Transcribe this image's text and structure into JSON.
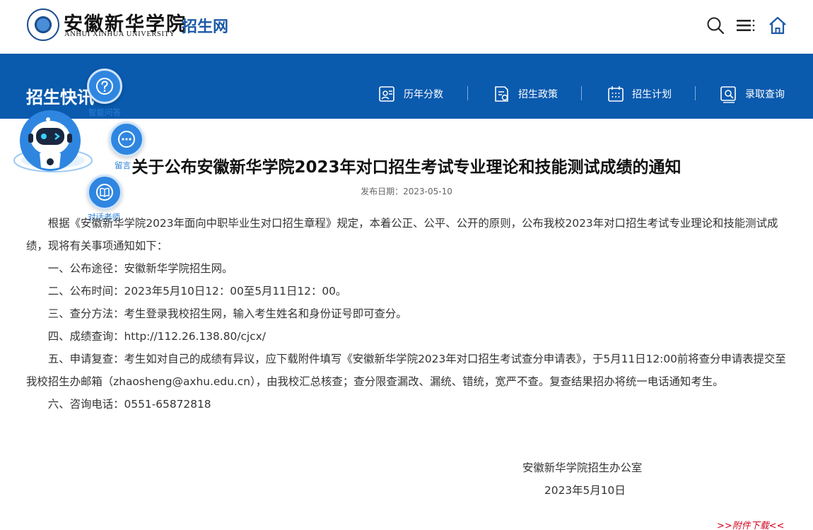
{
  "header": {
    "logo_cn": "安徽新华学院",
    "logo_en": "ANHUI XINHUA UNIVERSITY",
    "site_name": "招生网"
  },
  "band": {
    "title": "招生快讯",
    "nav": [
      {
        "label": "历年分数",
        "icon": "score-history-icon"
      },
      {
        "label": "招生政策",
        "icon": "policy-icon"
      },
      {
        "label": "招生计划",
        "icon": "calendar-icon"
      },
      {
        "label": "录取查询",
        "icon": "admission-query-icon"
      }
    ]
  },
  "assistant": {
    "qa_label": "智能问答",
    "msg_label": "留言",
    "teacher_label": "对话老师"
  },
  "article": {
    "title": "关于公布安徽新华学院2023年对口招生考试专业理论和技能测试成绩的通知",
    "date": "发布日期：2023-05-10",
    "paragraphs": [
      "根据《安徽新华学院2023年面向中职毕业生对口招生章程》规定，本着公正、公平、公开的原则，公布我校2023年对口招生考试专业理论和技能测试成绩，现将有关事项通知如下：",
      "一、公布途径：安徽新华学院招生网。",
      "二、公布时间：2023年5月10日12：00至5月11日12：00。",
      "三、查分方法：考生登录我校招生网，输入考生姓名和身份证号即可查分。",
      "四、成绩查询：http://112.26.138.80/cjcx/",
      "五、申请复查：考生如对自己的成绩有异议，应下载附件填写《安徽新华学院2023年对口招生考试查分申请表》，于5月11日12:00前将查分申请表提交至我校招生办邮箱（zhaosheng@axhu.edu.cn），由我校汇总核查；查分限查漏改、漏统、错统，宽严不查。复查结果招办将统一电话通知考生。",
      "六、咨询电话：0551-65872818"
    ],
    "signature": "安徽新华学院招生办公室",
    "sign_date": "2023年5月10日",
    "attachment_label": ">>附件下载<<"
  },
  "colors": {
    "brand_blue": "#0a5aae",
    "link_red": "#d0021b"
  }
}
